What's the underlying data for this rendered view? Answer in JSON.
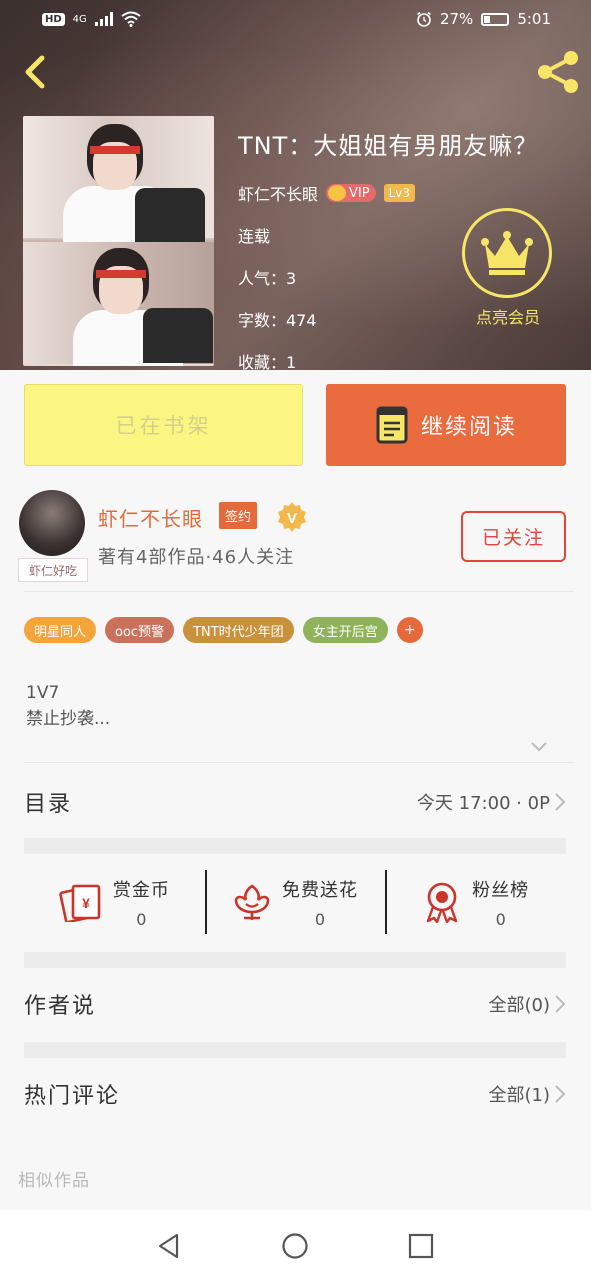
{
  "status_bar": {
    "hd": "HD",
    "network": "4G",
    "battery": "27%",
    "time": "5:01"
  },
  "book": {
    "title": "TNT：大姐姐有男朋友嘛？",
    "author": "虾仁不长眼",
    "vip_label": "VIP",
    "level": "Lv3",
    "status": "连载",
    "popularity": "人气：3",
    "word_count": "字数：474",
    "favorites": "收藏：1"
  },
  "member": {
    "label": "点亮会员"
  },
  "actions": {
    "shelf_label": "已在书架",
    "read_label": "继续阅读"
  },
  "author_card": {
    "avatar_caption": "虾仁好吃",
    "name": "虾仁不长眼",
    "sign_badge": "签约",
    "verified": "V",
    "stats": "著有4部作品·46人关注",
    "follow_label": "已关注"
  },
  "tags": [
    {
      "label": "明星同人",
      "color": "#f3a53b"
    },
    {
      "label": "ooc预警",
      "color": "#c9715a"
    },
    {
      "label": "TNT时代少年团",
      "color": "#c9913b"
    },
    {
      "label": "女主开后宫",
      "color": "#8fb35a"
    }
  ],
  "tag_more": "+",
  "summary": {
    "line1": "1V7",
    "line2": "禁止抄袭..."
  },
  "catalog": {
    "title": "目录",
    "updated": "今天 17:00 · 0P"
  },
  "stats": [
    {
      "label": "赏金币",
      "value": "0",
      "icon": "red-envelope-icon"
    },
    {
      "label": "免费送花",
      "value": "0",
      "icon": "flower-icon"
    },
    {
      "label": "粉丝榜",
      "value": "0",
      "icon": "medal-icon"
    }
  ],
  "author_says": {
    "title": "作者说",
    "all": "全部(0)"
  },
  "hot_comments": {
    "title": "热门评论",
    "all": "全部(1)"
  },
  "similar": "相似作品",
  "colors": {
    "accent": "#ea6b3d",
    "shelf_bg": "#fbf582",
    "follow": "#e0463c",
    "member": "#f6e567"
  }
}
